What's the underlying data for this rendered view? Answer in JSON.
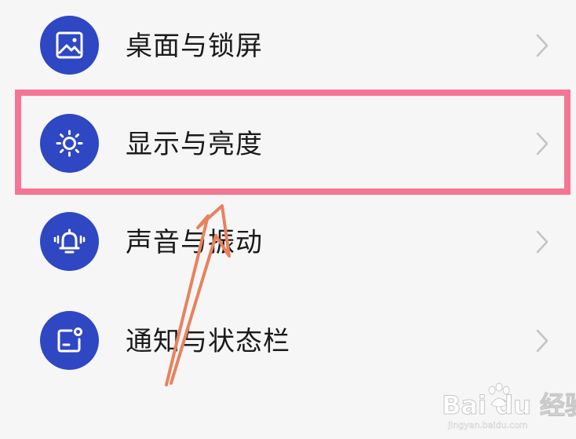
{
  "settings": {
    "items": [
      {
        "label": "桌面与锁屏",
        "icon": "image-icon"
      },
      {
        "label": "显示与亮度",
        "icon": "sun-icon"
      },
      {
        "label": "声音与振动",
        "icon": "bell-vibrate-icon"
      },
      {
        "label": "通知与状态栏",
        "icon": "notification-icon"
      }
    ],
    "highlighted_index": 1
  },
  "colors": {
    "icon_background": "#2f47c3",
    "highlight_border": "#f57594",
    "arrow": "#e8825e",
    "background": "#f6f6f6"
  },
  "watermark": {
    "brand": "Bai du 经验",
    "url": "jingyan.baidu.com"
  }
}
